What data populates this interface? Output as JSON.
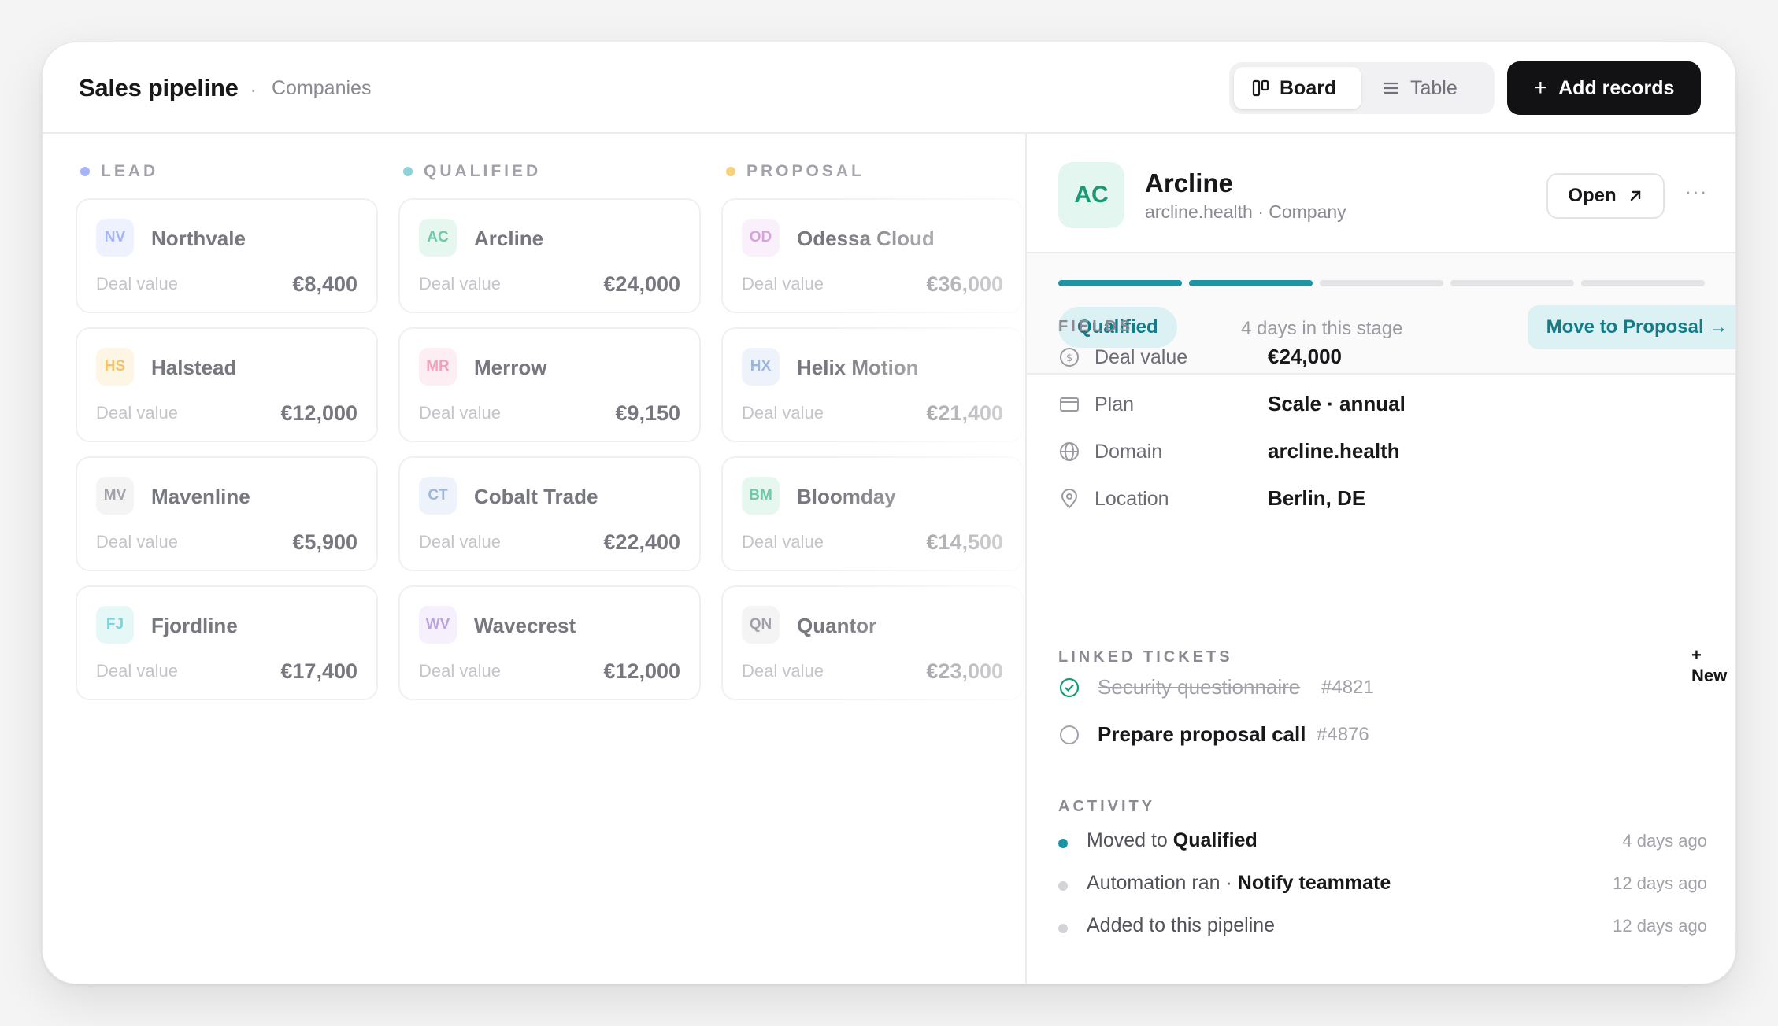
{
  "header": {
    "title": "Sales pipeline",
    "separator": "·",
    "subtitle": "Companies",
    "views": [
      {
        "label": "Board",
        "icon": "board-icon",
        "selected": true
      },
      {
        "label": "Table",
        "icon": "table-icon",
        "selected": false
      }
    ],
    "add_label": "Add records"
  },
  "columns": [
    {
      "label": "LEAD",
      "dot_color": "#a5b4fc",
      "cards": [
        {
          "initials": "NV",
          "name": "Northvale",
          "value_label": "Deal value",
          "value": "€8,400",
          "badge_bg": "#eef2ff",
          "badge_fg": "#a5b4fc"
        },
        {
          "initials": "HS",
          "name": "Halstead",
          "value_label": "Deal value",
          "value": "€12,000",
          "badge_bg": "#fef6e4",
          "badge_fg": "#f3c46b"
        },
        {
          "initials": "MV",
          "name": "Mavenline",
          "value_label": "Deal value",
          "value": "€5,900",
          "badge_bg": "#f4f4f5",
          "badge_fg": "#a1a1aa"
        },
        {
          "initials": "FJ",
          "name": "Fjordline",
          "value_label": "Deal value",
          "value": "€17,400",
          "badge_bg": "#e6f7f7",
          "badge_fg": "#7dd3d8"
        }
      ]
    },
    {
      "label": "QUALIFIED",
      "dot_color": "#8fd3d9",
      "cards": [
        {
          "initials": "AC",
          "name": "Arcline",
          "value_label": "Deal value",
          "value": "€24,000",
          "badge_bg": "#e6f7f0",
          "badge_fg": "#6fc9a8"
        },
        {
          "initials": "MR",
          "name": "Merrow",
          "value_label": "Deal value",
          "value": "€9,150",
          "badge_bg": "#fdeef3",
          "badge_fg": "#f0a3bd"
        },
        {
          "initials": "CT",
          "name": "Cobalt Trade",
          "value_label": "Deal value",
          "value": "€22,400",
          "badge_bg": "#eef3fb",
          "badge_fg": "#9db6db"
        },
        {
          "initials": "WV",
          "name": "Wavecrest",
          "value_label": "Deal value",
          "value": "€12,000",
          "badge_bg": "#f5f0fb",
          "badge_fg": "#b9a3d9"
        }
      ]
    },
    {
      "label": "PROPOSAL",
      "dot_color": "#f6d27e",
      "cards": [
        {
          "initials": "OD",
          "name": "Odessa Cloud",
          "value_label": "Deal value",
          "value": "€36,000",
          "badge_bg": "#faf0fb",
          "badge_fg": "#d8a3dc"
        },
        {
          "initials": "HX",
          "name": "Helix Motion",
          "value_label": "Deal value",
          "value": "€21,400",
          "badge_bg": "#eef3fb",
          "badge_fg": "#9db6db"
        },
        {
          "initials": "BM",
          "name": "Bloomday",
          "value_label": "Deal value",
          "value": "€14,500",
          "badge_bg": "#e6f7f0",
          "badge_fg": "#6fc9a8"
        },
        {
          "initials": "QN",
          "name": "Quantor",
          "value_label": "Deal value",
          "value": "€23,000",
          "badge_bg": "#f4f4f5",
          "badge_fg": "#a1a1aa"
        }
      ]
    }
  ],
  "detail": {
    "initials": "AC",
    "name": "Arcline",
    "subtitle": "arcline.health · Company",
    "open_label": "Open",
    "more_label": "···",
    "stage_progress": {
      "completed": 2,
      "total": 5
    },
    "stage": "Qualified",
    "stage_days": "4 days in this stage",
    "move_label": "Move to Proposal →",
    "fields_heading": "FIELDS",
    "fields": [
      {
        "icon": "currency-icon",
        "label": "Deal value",
        "value": "€24,000"
      },
      {
        "icon": "card-icon",
        "label": "Plan",
        "value": "Scale · annual"
      },
      {
        "icon": "globe-icon",
        "label": "Domain",
        "value": "arcline.health"
      },
      {
        "icon": "location-pin-icon",
        "label": "Location",
        "value": "Berlin, DE"
      }
    ],
    "tickets_heading": "LINKED TICKETS",
    "new_label": "+ New",
    "tickets": [
      {
        "title": "Security questionnaire",
        "number": "#4821",
        "done": true
      },
      {
        "title": "Prepare proposal call",
        "number": "#4876",
        "done": false
      }
    ],
    "activity_heading": "ACTIVITY",
    "activity": [
      {
        "prefix": "Moved to ",
        "bold": "Qualified",
        "time": "4 days ago",
        "active": true
      },
      {
        "prefix": "Automation ran · ",
        "bold": "Notify teammate",
        "time": "12 days ago",
        "active": false
      },
      {
        "prefix": "Added to this pipeline",
        "bold": "",
        "time": "12 days ago",
        "active": false
      }
    ]
  },
  "colors": {
    "accent": "#1d95a5",
    "accent_soft": "#dcf1f3",
    "primary_button": "#121214"
  }
}
